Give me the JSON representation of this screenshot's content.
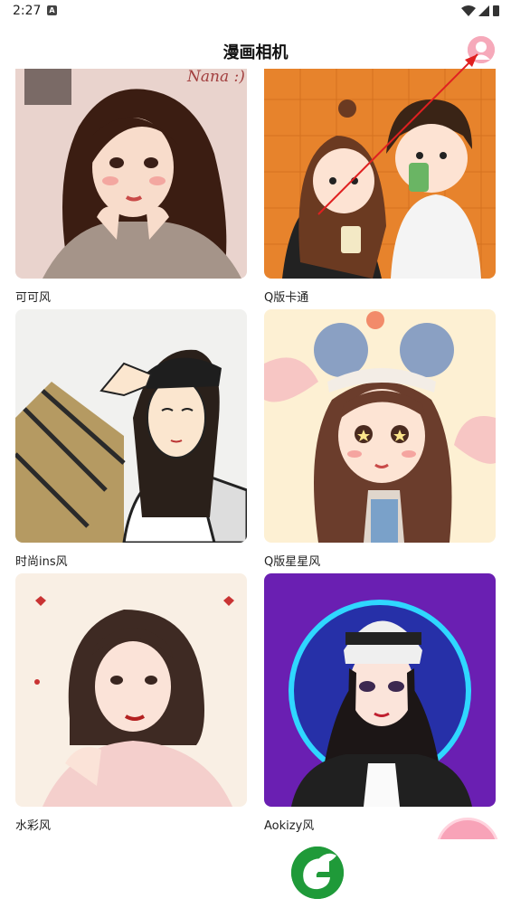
{
  "status_bar": {
    "time": "2:27",
    "a_icon": "A"
  },
  "header": {
    "title": "漫画相机"
  },
  "styles": [
    {
      "label": "可可风"
    },
    {
      "label": "Q版卡通"
    },
    {
      "label": "时尚ins风"
    },
    {
      "label": "Q版星星风"
    },
    {
      "label": "水彩风"
    },
    {
      "label": "Aokizy风"
    }
  ],
  "thumbnails": {
    "s1_signature": "Nana :)"
  },
  "icons": {
    "profile": "profile-icon",
    "camera": "camera-leaf-icon",
    "wifi": "wifi-icon",
    "signal": "signal-icon",
    "battery": "battery-icon"
  },
  "colors": {
    "accent_pink": "#f6a9ba",
    "camera_green": "#1f9a39",
    "annotation_red": "#e02020"
  }
}
